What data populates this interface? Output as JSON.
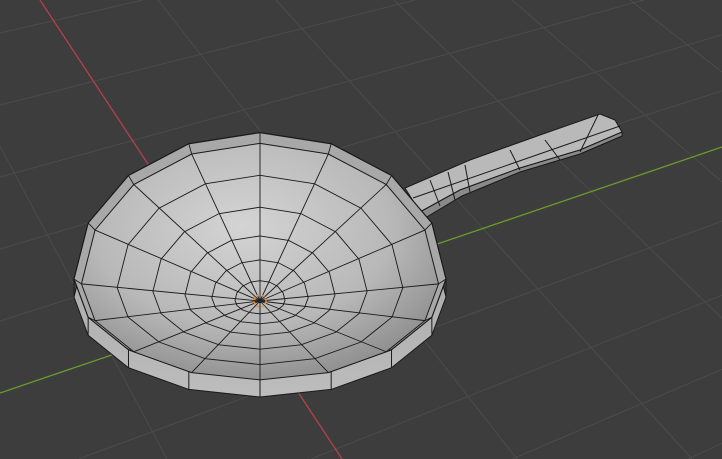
{
  "viewport": {
    "object": "frying-pan-mesh",
    "colors": {
      "background": "#3d3d3d",
      "grid": "#4b4b4b",
      "x_axis": "#b4404e",
      "y_axis": "#6a9c2c",
      "mesh_light": "#c8c8c8",
      "mesh_dark": "#8e8e8e",
      "edge": "#1a1a1a",
      "origin": "#f08a2a"
    }
  }
}
